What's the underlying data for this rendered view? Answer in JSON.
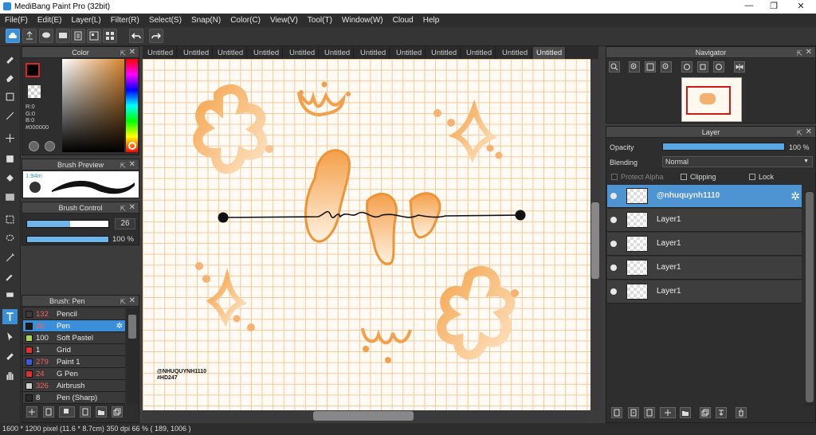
{
  "window": {
    "title": "MediBang Paint Pro (32bit)",
    "min": "—",
    "max": "❐",
    "close": "✕"
  },
  "menu": [
    "File(F)",
    "Edit(E)",
    "Layer(L)",
    "Filter(R)",
    "Select(S)",
    "Snap(N)",
    "Color(C)",
    "View(V)",
    "Tool(T)",
    "Window(W)",
    "Cloud",
    "Help"
  ],
  "panels": {
    "color": {
      "title": "Color",
      "r": "R:0",
      "g": "G:0",
      "b": "B:0",
      "hex": "#000000"
    },
    "brush_preview": {
      "title": "Brush Preview",
      "size": "1.94m"
    },
    "brush_control": {
      "title": "Brush Control",
      "size": "26",
      "opacity": "100 %",
      "size_level": 0.53,
      "opacity_level": 1.0
    },
    "brush_list": {
      "title": "Brush: Pen",
      "items": [
        {
          "size": "132",
          "name": "Pencil",
          "color": "#3a3a3a",
          "red": true
        },
        {
          "size": "26",
          "name": "Pen",
          "color": "#1a1a1a",
          "red": true,
          "selected": true
        },
        {
          "size": "100",
          "name": "Soft Pastel",
          "color": "#a6d84a",
          "red": false
        },
        {
          "size": "1",
          "name": "Grid",
          "color": "#e03030",
          "red": false
        },
        {
          "size": "279",
          "name": "Paint 1",
          "color": "#3b5bd8",
          "red": true
        },
        {
          "size": "24",
          "name": "G Pen",
          "color": "#e03030",
          "red": true
        },
        {
          "size": "326",
          "name": "Airbrush",
          "color": "#cfcfcf",
          "red": true
        },
        {
          "size": "8",
          "name": "Pen (Sharp)",
          "color": "#2a2a2a",
          "red": false
        }
      ]
    },
    "navigator": {
      "title": "Navigator"
    },
    "layer": {
      "title": "Layer",
      "opacity_label": "Opacity",
      "opacity": "100 %",
      "blending_label": "Blending",
      "blending": "Normal",
      "protect_alpha": "Protect Alpha",
      "clipping": "Clipping",
      "lock": "Lock",
      "layers": [
        "@nhuquynh1110",
        "Layer1",
        "Layer1",
        "Layer1",
        "Layer1"
      ]
    }
  },
  "tabs": [
    "Untitled",
    "Untitled",
    "Untitled",
    "Untitled",
    "Untitled",
    "Untitled",
    "Untitled",
    "Untitled",
    "Untitled",
    "Untitled",
    "Untitled",
    "Untitled"
  ],
  "canvas": {
    "watermark1": "@NHUQUYNH1110",
    "watermark2": "#HD247"
  },
  "status": "1600 * 1200 pixel   (11.6 * 8.7cm)   350 dpi   66 %   ( 189, 1006 )"
}
